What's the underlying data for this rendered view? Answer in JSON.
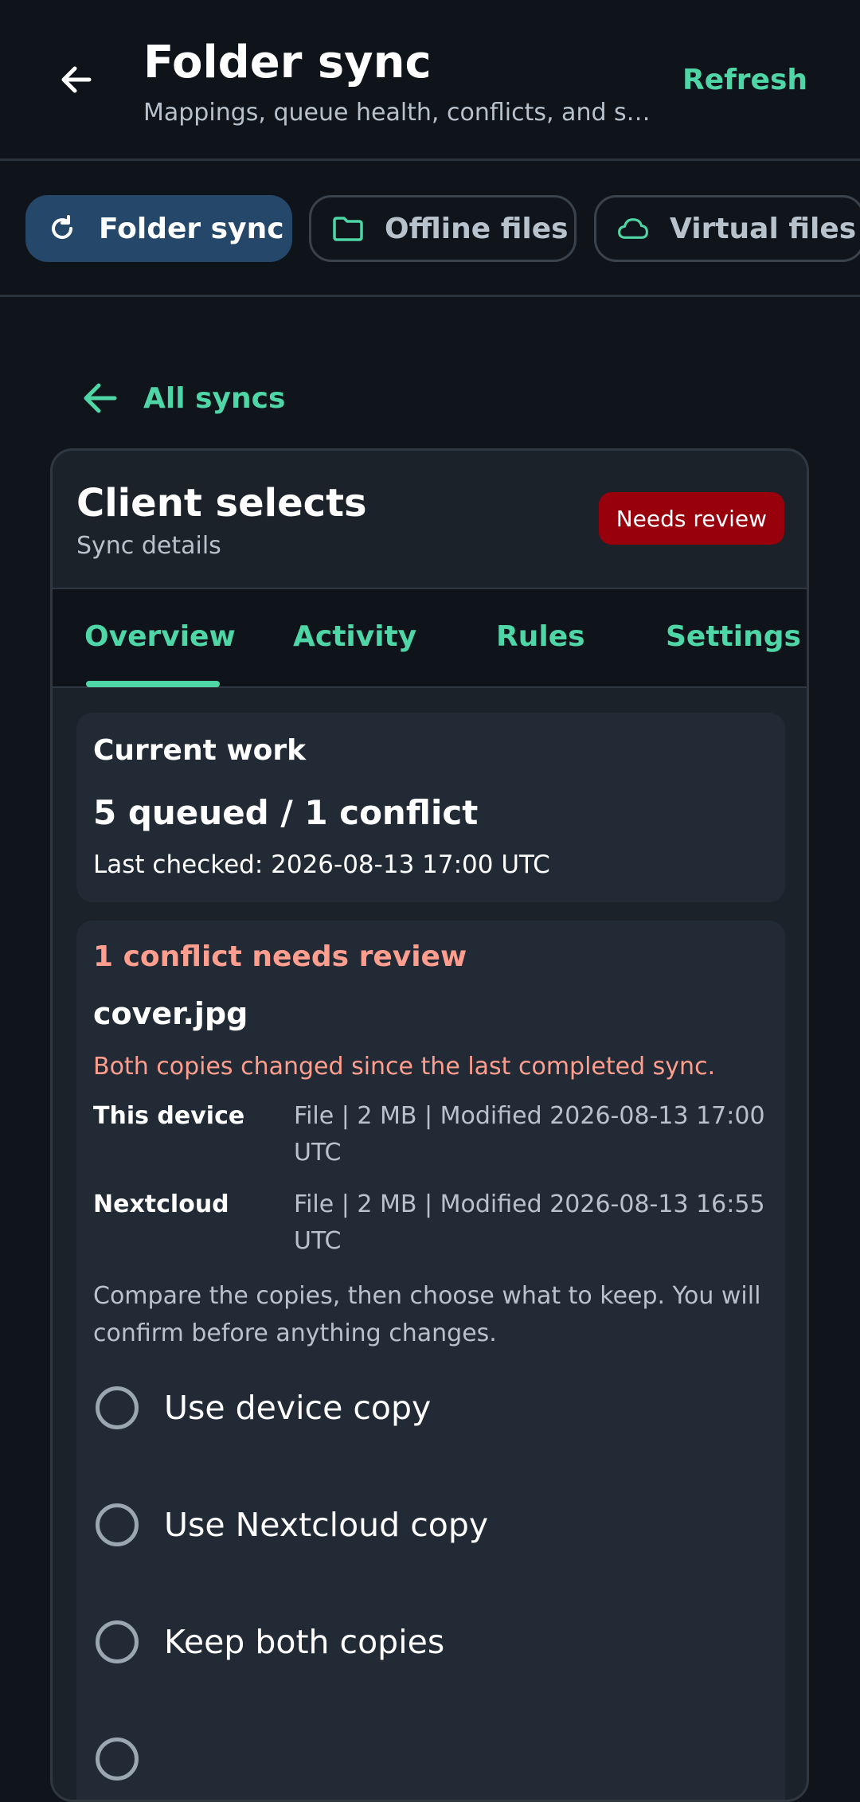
{
  "header": {
    "title": "Folder sync",
    "subtitle": "Mappings, queue health, conflicts, and sy...",
    "refresh_label": "Refresh"
  },
  "chips": [
    {
      "label": "Folder sync",
      "icon": "refresh-icon",
      "active": true
    },
    {
      "label": "Offline files",
      "icon": "folder-icon",
      "active": false
    },
    {
      "label": "Virtual files",
      "icon": "cloud-icon",
      "active": false
    }
  ],
  "back_link": {
    "label": "All syncs"
  },
  "card": {
    "title": "Client selects",
    "subtitle": "Sync details",
    "badge": "Needs review"
  },
  "tabs": [
    {
      "label": "Overview",
      "selected": true
    },
    {
      "label": "Activity",
      "selected": false
    },
    {
      "label": "Rules",
      "selected": false
    },
    {
      "label": "Settings",
      "selected": false
    }
  ],
  "current_work": {
    "heading": "Current work",
    "summary": "5 queued / 1 conflict",
    "last_checked": "Last checked: 2026-08-13 17:00 UTC"
  },
  "conflict": {
    "heading": "1 conflict needs review",
    "file_name": "cover.jpg",
    "description": "Both copies changed since the last completed sync.",
    "rows": [
      {
        "label": "This device",
        "value": "File | 2 MB | Modified 2026-08-13 17:00 UTC"
      },
      {
        "label": "Nextcloud",
        "value": "File | 2 MB | Modified 2026-08-13 16:55 UTC"
      }
    ],
    "note": "Compare the copies, then choose what to keep. You will confirm before anything changes.",
    "options": [
      {
        "label": "Use device copy",
        "selected": false
      },
      {
        "label": "Use Nextcloud copy",
        "selected": false
      },
      {
        "label": "Keep both copies",
        "selected": false
      },
      {
        "label": "",
        "selected": false
      }
    ]
  },
  "colors": {
    "accent": "#4fd6a6",
    "danger_badge": "#98000b",
    "conflict_text": "#ff9e8e",
    "active_chip": "#24476a",
    "background": "#10151b"
  }
}
